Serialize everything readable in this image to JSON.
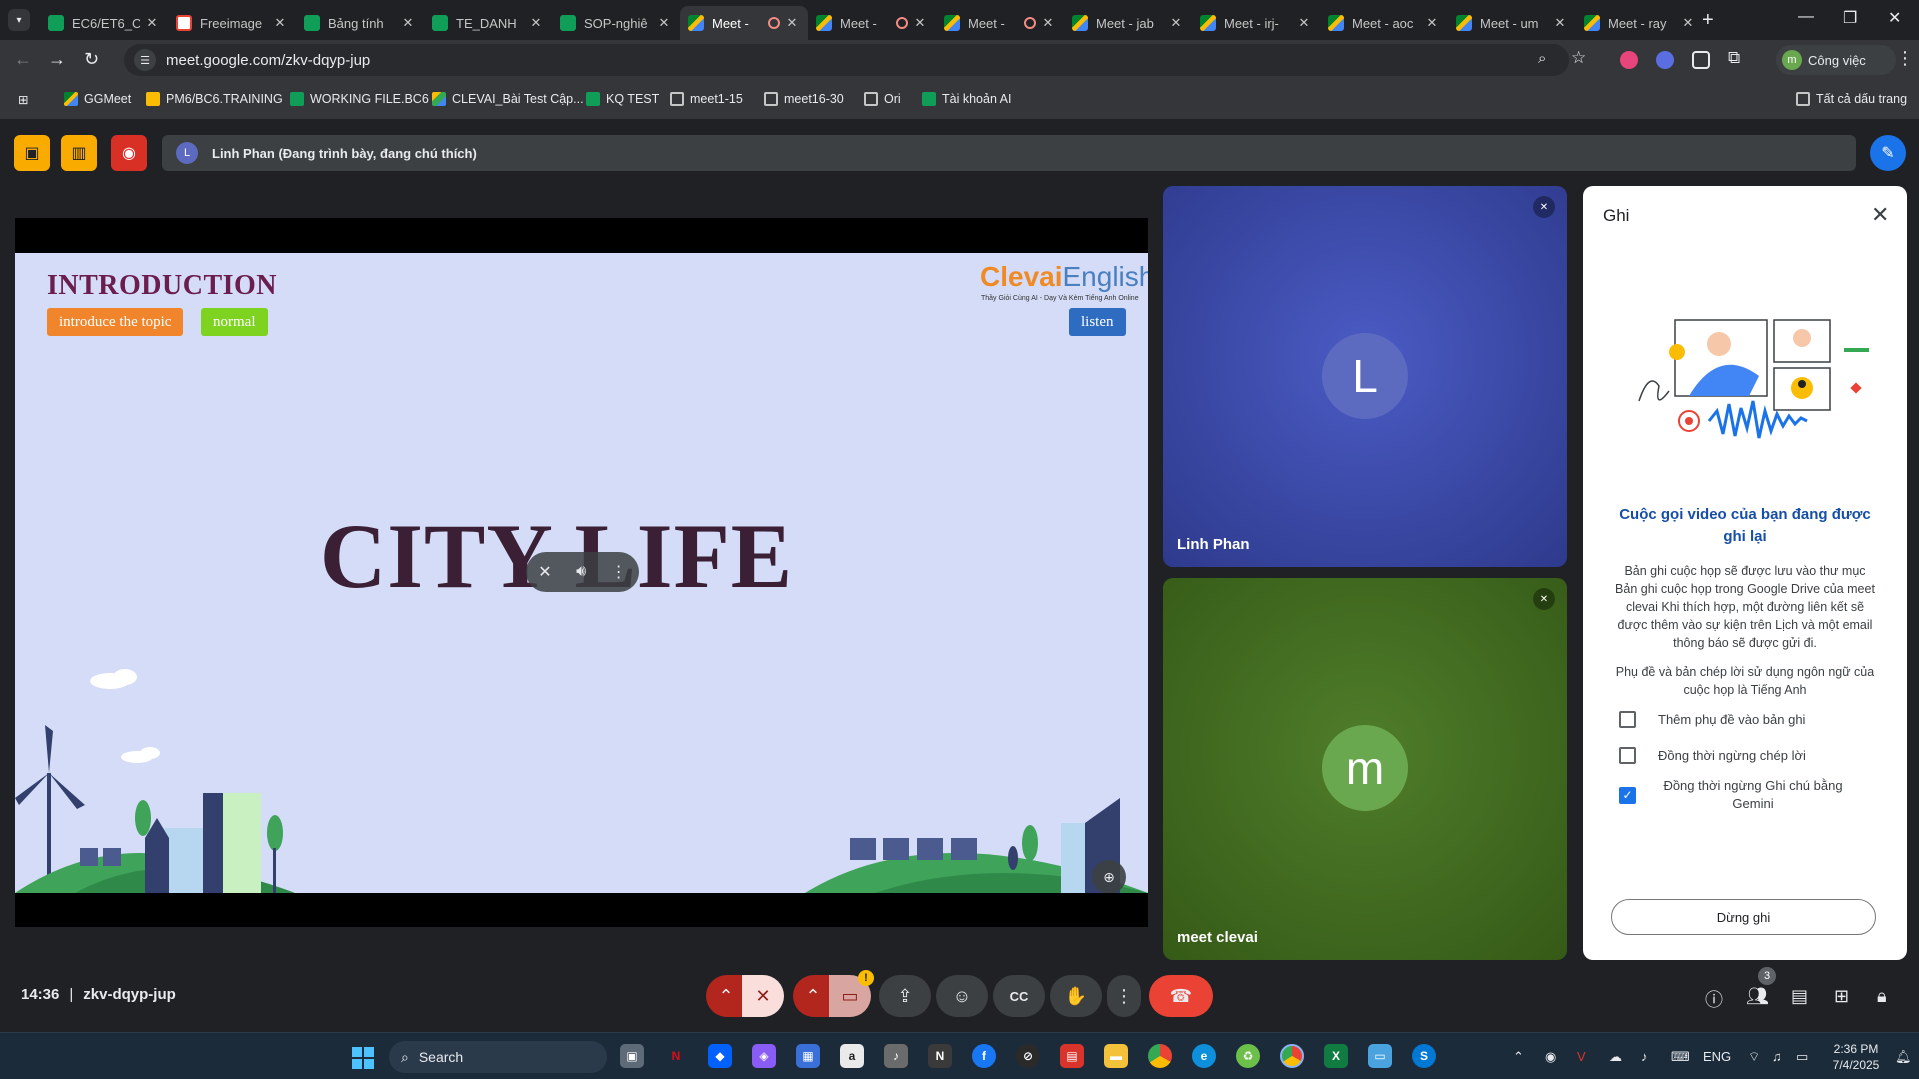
{
  "browser": {
    "tabs": [
      {
        "label": "EC6/ET6_C",
        "icon": "sheets"
      },
      {
        "label": "Freeimage",
        "icon": "freeimage"
      },
      {
        "label": "Bảng tính",
        "icon": "sheets"
      },
      {
        "label": "TE_DANH",
        "icon": "sheets"
      },
      {
        "label": "SOP-nghiê",
        "icon": "sheets"
      },
      {
        "label": "Meet -",
        "icon": "meet",
        "active": true,
        "recording": true
      },
      {
        "label": "Meet -",
        "icon": "meet",
        "recording": true
      },
      {
        "label": "Meet -",
        "icon": "meet",
        "recording": true
      },
      {
        "label": "Meet - jab",
        "icon": "meet"
      },
      {
        "label": "Meet - irj-",
        "icon": "meet"
      },
      {
        "label": "Meet - aoc",
        "icon": "meet"
      },
      {
        "label": "Meet - um",
        "icon": "meet"
      },
      {
        "label": "Meet - ray",
        "icon": "meet"
      }
    ],
    "url": "meet.google.com/zkv-dqyp-jup",
    "profile_label": "Công việc",
    "profile_initial": "m",
    "bookmarks": [
      {
        "label": "GGMeet",
        "icon": "meet"
      },
      {
        "label": "PM6/BC6.TRAINING",
        "icon": "folder-yellow"
      },
      {
        "label": "WORKING FILE.BC6",
        "icon": "sheets"
      },
      {
        "label": "CLEVAI_Bài Test Cập...",
        "icon": "drive"
      },
      {
        "label": "KQ TEST",
        "icon": "sheets"
      },
      {
        "label": "meet1-15",
        "icon": "folder"
      },
      {
        "label": "meet16-30",
        "icon": "folder"
      },
      {
        "label": "Ori",
        "icon": "folder"
      },
      {
        "label": "Tài khoản AI",
        "icon": "sheets"
      }
    ],
    "all_bookmarks_label": "Tất cả dấu trang"
  },
  "meet": {
    "presenter_initial": "L",
    "presenter_text": "Linh Phan (Đang trình bày, đang chú thích)",
    "slide": {
      "title": "INTRODUCTION",
      "tag1": "introduce the topic",
      "tag2": "normal",
      "tag3": "listen",
      "logo_main": "Clevai",
      "logo_sub": "English",
      "logo_tagline": "Thầy Giỏi Cùng AI - Dạy Và Kèm Tiếng Anh Online",
      "headline": "CITY LIFE"
    },
    "participants": [
      {
        "name": "Linh Phan",
        "initial": "L"
      },
      {
        "name": "meet clevai",
        "initial": "m"
      }
    ],
    "recording_panel": {
      "title": "Ghi",
      "heading": "Cuộc gọi video của bạn đang được ghi lại",
      "body": "Bản ghi cuộc họp sẽ được lưu vào thư mục Bản ghi cuộc họp trong Google Drive của meet clevai Khi thích hợp, một đường liên kết sẽ được thêm vào sự kiện trên Lịch và một email thông báo sẽ được gửi đi.",
      "lang_note": "Phụ đề và bản chép lời sử dụng ngôn ngữ của cuộc họp là Tiếng Anh",
      "options": [
        {
          "label": "Thêm phụ đề vào bản ghi",
          "checked": false
        },
        {
          "label": "Đồng thời ngừng chép lời",
          "checked": false
        },
        {
          "label": "Đồng thời ngừng Ghi chú bằng Gemini",
          "checked": true
        }
      ],
      "stop_label": "Dừng ghi"
    },
    "time": "14:36",
    "meeting_code": "zkv-dqyp-jup",
    "people_count": "3"
  },
  "taskbar": {
    "search_label": "Search",
    "lang": "ENG",
    "time": "2:36 PM",
    "date": "7/4/2025"
  },
  "colors": {
    "accent_blue": "#1a73e8",
    "end_call_red": "#ea4335",
    "tile1_bg": "#3949ab",
    "tile2_bg": "#3d6b1f"
  }
}
